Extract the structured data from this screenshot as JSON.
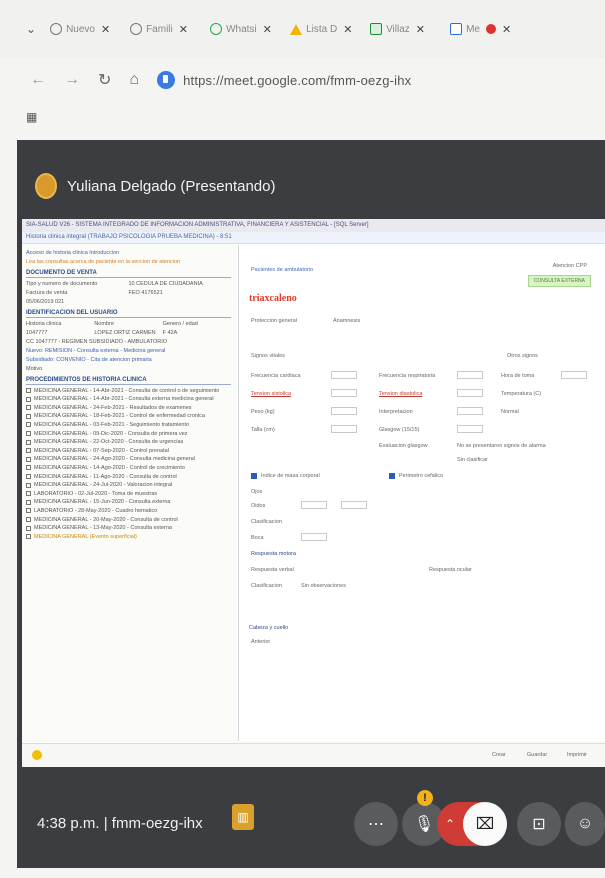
{
  "browser": {
    "tabs": [
      {
        "label": "Nuevo",
        "icon": "globe-icon"
      },
      {
        "label": "Famili",
        "icon": "globe-icon"
      },
      {
        "label": "Whatsi",
        "icon": "whatsapp-icon"
      },
      {
        "label": "Lista D",
        "icon": "drive-icon"
      },
      {
        "label": "Villaz",
        "icon": "sheets-icon"
      },
      {
        "label": "Me",
        "icon": "meet-icon"
      }
    ],
    "url": "https://meet.google.com/fmm-oezg-ihx",
    "apps_icon": "apps-grid-icon"
  },
  "meet": {
    "presenter": "Yuliana Delgado (Presentando)",
    "time": "4:38 p.m.",
    "separator": "|",
    "meeting_code": "fmm-oezg-ihx",
    "warning_badge": "!"
  },
  "shared_screen": {
    "app_title": "SIA-SALUD V26 - SISTEMA INTEGRADO DE INFORMACION ADMINISTRATIVA, FINANCIERA Y ASISTENCIAL - [SQL Server]",
    "breadcrumb": "Historia clinica integral (TRABAJO PSICOLOGIA PRUEBA MEDICINA) - 8:51",
    "left": {
      "top_line": "Acceso de historia clinica   Introduccion",
      "warning_line": "Lea las consultas acerca de paciente en la seccion de atencion",
      "sec1": "DOCUMENTO DE VENTA",
      "rows1": [
        [
          "Tipo y numero de documento",
          "10 CEDULA DE CIUDADANIA"
        ],
        [
          "Factura de venta",
          "FEO 4176521"
        ],
        [
          "05/06/2019 021",
          ""
        ]
      ],
      "sec2": "IDENTIFICACION DEL USUARIO",
      "rows2": [
        [
          "Historia clinica",
          "Nombre",
          "Genero / edad"
        ],
        [
          "1047777",
          "LOPEZ ORTIZ CARMEN",
          "F 42A"
        ]
      ],
      "info1": "CC 1047777 - REGIMEN SUBSIDIADO - AMBULATORIO",
      "info2": "Nuevo: REMISION - Consulta externa - Medicina general",
      "info3": "Subsidiado: CONVENIO - Cita de atencion primaria",
      "info4": "Motivo",
      "sec3": "PROCEDIMIENTOS DE HISTORIA CLINICA",
      "procs": [
        "MEDICINA GENERAL - 14-Abr-2021 - Consulta de control o de seguimiento",
        "MEDICINA GENERAL - 14-Abr-2021 - Consulta externa medicina general",
        "MEDICINA GENERAL - 24-Feb-2021 - Resultados de examenes",
        "MEDICINA GENERAL - 18-Feb-2021 - Control de enfermedad cronica",
        "MEDICINA GENERAL - 03-Feb-2021 - Seguimiento tratamiento",
        "MEDICINA GENERAL - 09-Dic-2020 - Consulta de primera vez",
        "MEDICINA GENERAL - 22-Oct-2020 - Consulta de urgencias",
        "MEDICINA GENERAL - 07-Sep-2020 - Control prenatal",
        "MEDICINA GENERAL - 24-Ago-2020 - Consulta medicina general",
        "MEDICINA GENERAL - 14-Ago-2020 - Control de crecimiento",
        "MEDICINA GENERAL - 11-Ago-2020 - Consulta de control",
        "MEDICINA GENERAL - 24-Jul-2020 - Valoracion integral",
        "LABORATORIO - 02-Jul-2020 - Toma de muestras",
        "MEDICINA GENERAL - 15-Jun-2020 - Consulta externa",
        "LABORATORIO - 28-May-2020 - Cuadro hematico",
        "MEDICINA GENERAL - 20-May-2020 - Consulta de control",
        "MEDICINA GENERAL - 13-May-2020 - Consulta externa",
        "MEDICINA GENERAL (Evento superficial)"
      ]
    },
    "right": {
      "link": "Pacientes de ambulatorio",
      "status": "Atencion CPP",
      "badge": "CONSULTA EXTERNA",
      "brand": "triaxcaleno",
      "sub": "Proteccion general",
      "sub2": "Anamnesis",
      "fields": {
        "signos": "Signos vitales",
        "frec_card": "Frecuencia cardiaca",
        "frec_resp": "Frecuencia respiratoria",
        "tension_sis": "Tension sistolica",
        "tension_dia": "Tension diastolica",
        "peso": "Peso (kg)",
        "talla": "Talla (cm)",
        "imc": "Indice de masa corporal",
        "perimetro": "Perimetro cefalico",
        "temperatura": "Temperatura (C)",
        "interpretacion": "Interpretacion",
        "normal": "Normal",
        "glasgow": "Glasgow (15/15)",
        "eval_glasgow": "Evaluacion glasgow",
        "obs_note": "No se presentaron signos de alarma",
        "sin_clasificar": "Sin clasificar",
        "otros": "Otros signos",
        "hora": "Hora de toma",
        "ojos": "Ojos",
        "oidos": "Oidos",
        "boca": "Boca",
        "motor": "Respuesta motora",
        "verbal": "Respuesta verbal",
        "ocular": "Respuesta ocular",
        "clasif": "Clasificacion",
        "sin_observ": "Sin observaciones",
        "cabeza": "Cabeza y cuello",
        "anterior": "Anterior"
      }
    },
    "footer": [
      "Crear",
      "Guardar",
      "Imprimir"
    ]
  }
}
